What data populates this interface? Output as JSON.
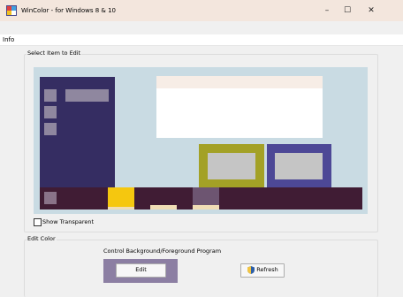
{
  "window": {
    "title": "WinColor - for Windows 8 & 10",
    "minimize_glyph": "–",
    "maximize_glyph": "☐",
    "close_glyph": "✕"
  },
  "menu": {
    "items": [
      "Info"
    ]
  },
  "select_group": {
    "label": "Select Item to Edit",
    "show_transparent_label": "Show Transparent",
    "show_transparent_checked": false
  },
  "preview_colors": {
    "background": "#c9dbe3",
    "start_menu": "#352d62",
    "tile": "#8f879f",
    "dialog_title": "#f7ede6",
    "dialog_body": "#ffffff",
    "olive_frame": "#a3a126",
    "blue_frame": "#4d4896",
    "inner_panel": "#c5c5c5",
    "taskbar": "#401c34",
    "taskbar_button": "#8a7389",
    "taskbar_active": "#f5c70f",
    "taskbar_hover": "#6d5571",
    "taskbar_indicator": "#f0ddb5"
  },
  "edit_group": {
    "label": "Edit Color",
    "instruction": "Control Background/Foreground Program",
    "edit_label": "Edit",
    "refresh_label": "Refresh",
    "edit_frame_color": "#8c7fa3"
  }
}
